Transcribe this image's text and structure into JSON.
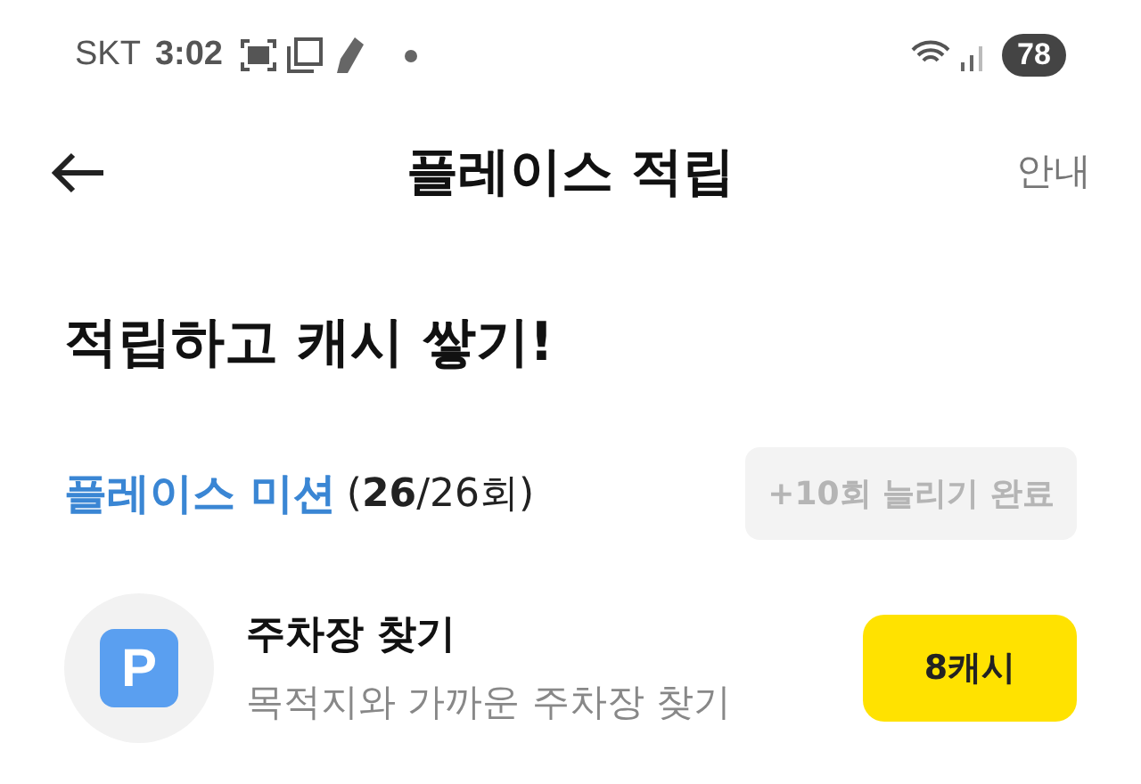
{
  "status_bar": {
    "carrier": "SKT",
    "time": "3:02",
    "battery": "78"
  },
  "header": {
    "title": "플레이스 적립",
    "link": "안내"
  },
  "heading": "적립하고 캐시 쌓기!",
  "mission": {
    "title": "플레이스 미션",
    "count": "(**26**/26회)",
    "button": {
      "label": "+10회 늘리기 완료",
      "disabled": true
    }
  },
  "items": [
    {
      "icon_letter": "P",
      "title": "주차장 찾기",
      "subtitle": "목적지와 가까운 주차장 찾기",
      "reward": "8캐시"
    }
  ]
}
